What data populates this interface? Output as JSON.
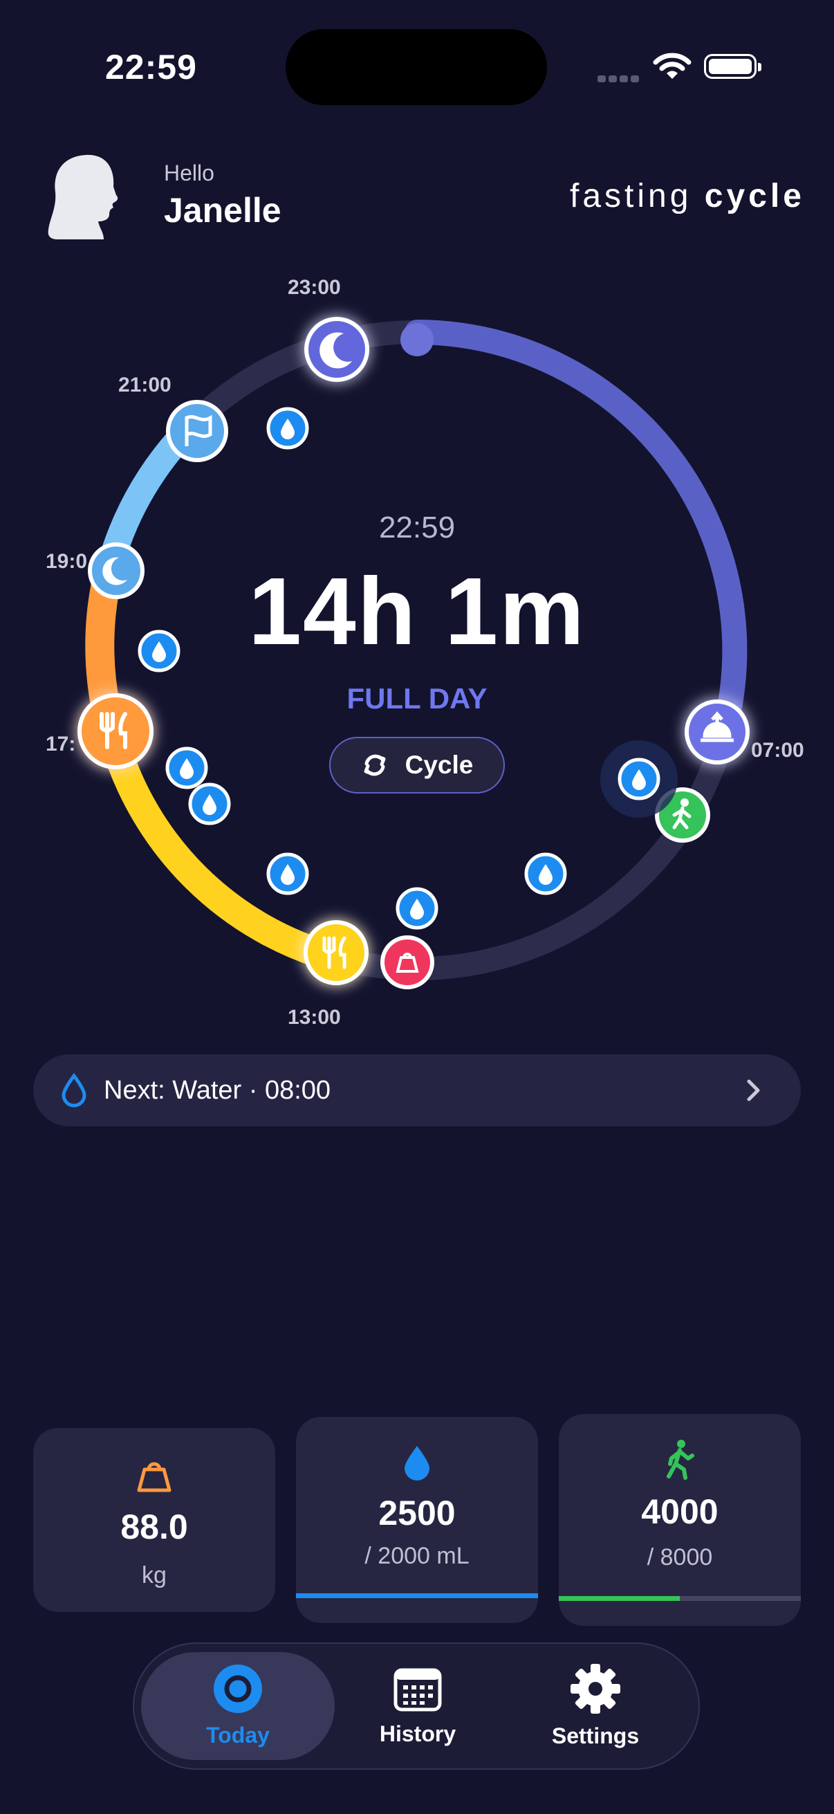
{
  "status_bar": {
    "time": "22:59"
  },
  "header": {
    "greeting": "Hello",
    "user_name": "Janelle",
    "brand_regular": "fasting ",
    "brand_bold": "cycle"
  },
  "dial": {
    "ring_labels": {
      "t2300": "23:00",
      "t2100": "21:00",
      "t1900": "19:0",
      "t1700": "17:",
      "t1300": "13:00",
      "t0700": "07:00"
    },
    "current_time": "22:59",
    "elapsed": "14h 1m",
    "phase": "FULL DAY",
    "cycle_button": "Cycle",
    "colors": {
      "track": "#2c2c4c",
      "fasting": "#5a61c6",
      "eating_yellow": "#ffd21f",
      "eating_orange": "#ff9a3c",
      "evening_blue": "#7cc4f6",
      "water": "#1d8cf0",
      "steps": "#35c35a",
      "weight": "#f0365c"
    }
  },
  "next_event": {
    "icon": "water-drop-outline-icon",
    "text": "Next: Water · 08:00"
  },
  "stats": {
    "weight": {
      "icon": "weight-scale-icon",
      "value": "88.0",
      "unit": "kg"
    },
    "water": {
      "icon": "water-drop-icon",
      "value": "2500",
      "goal": "/ 2000 mL",
      "progress": 1.0,
      "color": "#1d8cf0"
    },
    "steps": {
      "icon": "walking-icon",
      "value": "4000",
      "goal": "/ 8000",
      "progress": 0.5,
      "color": "#35c35a"
    }
  },
  "tabs": [
    {
      "label": "Today",
      "icon": "today-ring-icon",
      "active": true
    },
    {
      "label": "History",
      "icon": "calendar-icon",
      "active": false
    },
    {
      "label": "Settings",
      "icon": "gear-icon",
      "active": false
    }
  ]
}
